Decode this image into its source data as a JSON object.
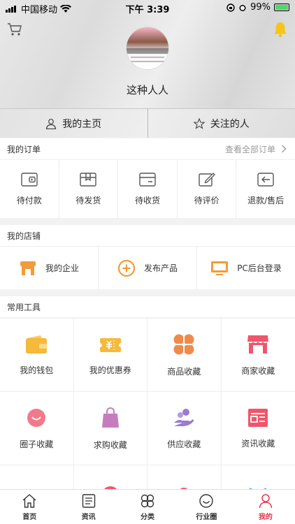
{
  "status": {
    "carrier": "中国移动",
    "time": "下午 3:39",
    "battery": "99%"
  },
  "header": {
    "username": "这种人人"
  },
  "profile_tabs": [
    {
      "label": "我的主页",
      "icon": "user-icon"
    },
    {
      "label": "关注的人",
      "icon": "star-icon"
    }
  ],
  "orders": {
    "title": "我的订单",
    "view_all": "查看全部订单",
    "items": [
      {
        "label": "待付款",
        "icon": "wallet-outline-icon"
      },
      {
        "label": "待发货",
        "icon": "box-icon"
      },
      {
        "label": "待收货",
        "icon": "package-receive-icon"
      },
      {
        "label": "待评价",
        "icon": "edit-icon"
      },
      {
        "label": "退款/售后",
        "icon": "return-icon"
      }
    ]
  },
  "shop": {
    "title": "我的店铺",
    "items": [
      {
        "label": "我的企业",
        "icon": "store-icon"
      },
      {
        "label": "发布产品",
        "icon": "add-circle-icon"
      },
      {
        "label": "PC后台登录",
        "icon": "monitor-icon"
      }
    ]
  },
  "tools": {
    "title": "常用工具",
    "items": [
      {
        "label": "我的钱包",
        "icon": "wallet-icon",
        "color": "#f5b93b"
      },
      {
        "label": "我的优惠券",
        "icon": "coupon-icon",
        "color": "#f5b93b"
      },
      {
        "label": "商品收藏",
        "icon": "clover-icon",
        "color": "#f08a4b"
      },
      {
        "label": "商家收藏",
        "icon": "shop-fav-icon",
        "color": "#f0566b"
      },
      {
        "label": "圈子收藏",
        "icon": "smile-icon",
        "color": "#f07a8a"
      },
      {
        "label": "求购收藏",
        "icon": "bag-icon",
        "color": "#c77bbf"
      },
      {
        "label": "供应收藏",
        "icon": "hand-icon",
        "color": "#9b7bd0"
      },
      {
        "label": "资讯收藏",
        "icon": "news-icon",
        "color": "#f0566b"
      },
      {
        "label": "",
        "icon": "partial-icon-1",
        "color": "#5b8ee6"
      },
      {
        "label": "",
        "icon": "partial-icon-2",
        "color": "#f0566b"
      },
      {
        "label": "",
        "icon": "partial-icon-3",
        "color": "#f0566b"
      },
      {
        "label": "",
        "icon": "partial-icon-4",
        "color": "#5b8ee6"
      }
    ]
  },
  "bottom_nav": [
    {
      "label": "首页",
      "icon": "home-icon",
      "active": false
    },
    {
      "label": "资讯",
      "icon": "news-list-icon",
      "active": false
    },
    {
      "label": "分类",
      "icon": "category-icon",
      "active": false
    },
    {
      "label": "行业圈",
      "icon": "circle-icon",
      "active": false
    },
    {
      "label": "我的",
      "icon": "person-icon",
      "active": true
    }
  ],
  "colors": {
    "accent": "#e8334a",
    "orange": "#f29b3a",
    "bell": "#f5c518"
  }
}
